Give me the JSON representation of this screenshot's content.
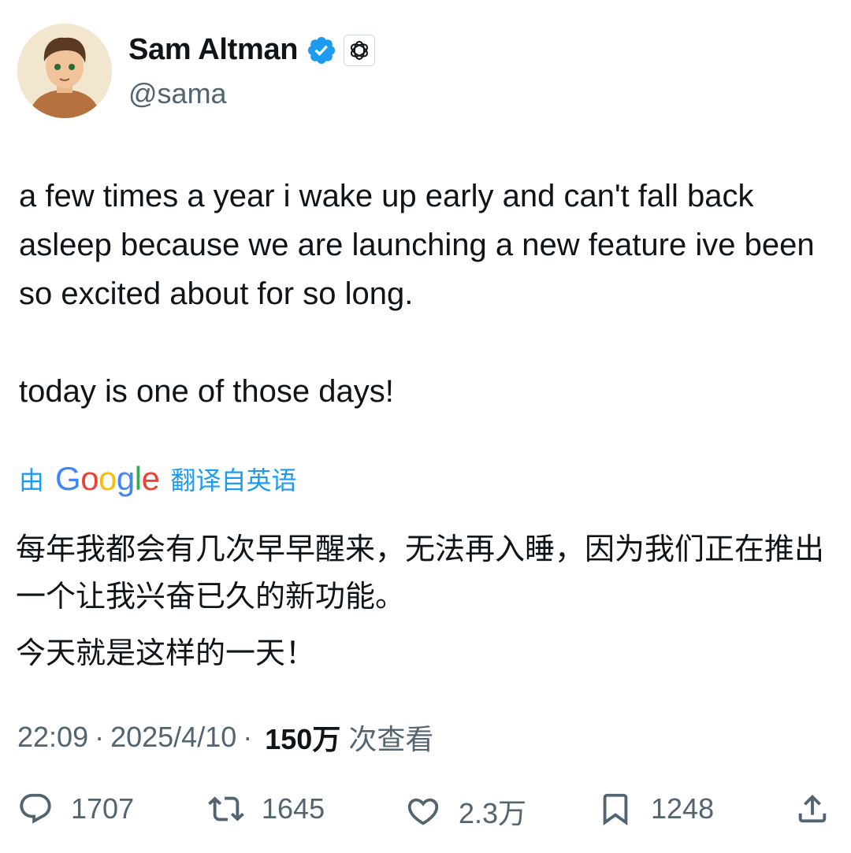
{
  "user": {
    "name": "Sam Altman",
    "handle": "@sama"
  },
  "tweet": {
    "paragraph1": "a few times a year i wake up early and can't fall back asleep because we are launching a new feature ive been so excited about for so long.",
    "paragraph2": "today is one of those days!"
  },
  "translation": {
    "prefix": "由",
    "provider_letters": [
      "G",
      "o",
      "o",
      "g",
      "l",
      "e"
    ],
    "suffix": "翻译自英语",
    "paragraph1": "每年我都会有几次早早醒来，无法再入睡，因为我们正在推出一个让我兴奋已久的新功能。",
    "paragraph2": "今天就是这样的一天！"
  },
  "meta": {
    "time": "22:09",
    "sep1": "·",
    "date": "2025/4/10",
    "sep2": "·",
    "views": "150万",
    "views_label": "次查看"
  },
  "actions": {
    "replies": "1707",
    "reposts": "1645",
    "likes": "2.3万",
    "bookmarks": "1248"
  },
  "colors": {
    "verified": "#1d9bf0",
    "link": "#1d9bf0",
    "secondary_text": "#536471"
  },
  "icons": [
    "verified-icon",
    "openai-icon",
    "reply-icon",
    "repost-icon",
    "like-icon",
    "bookmark-icon",
    "share-icon"
  ]
}
